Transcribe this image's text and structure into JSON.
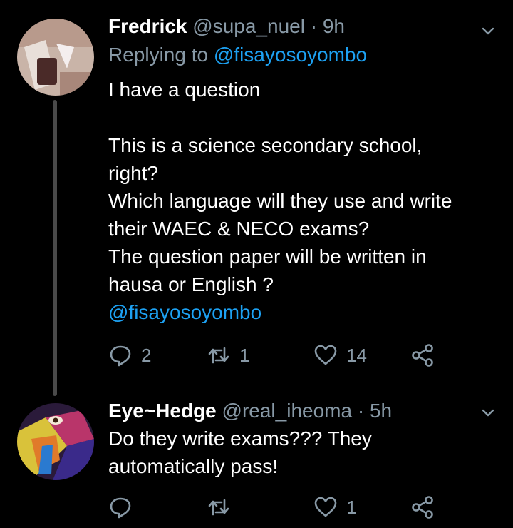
{
  "tweets": [
    {
      "name": "Fredrick",
      "handle": "@supa_nuel",
      "separator": "·",
      "time": "9h",
      "replying_prefix": "Replying to",
      "replying_to": "@fisayosoyombo",
      "body_lines": [
        "I have a question",
        "",
        "This is a science secondary school,",
        "right?",
        "Which language will they use and write",
        "their WAEC & NECO exams?",
        "The question paper will be written in",
        "hausa or English ?"
      ],
      "body_mention": "@fisayosoyombo",
      "reply_count": "2",
      "retweet_count": "1",
      "like_count": "14"
    },
    {
      "name": "Eye~Hedge",
      "handle": "@real_iheoma",
      "separator": "·",
      "time": "5h",
      "body_lines": [
        "Do they write exams??? They",
        "automatically pass!"
      ],
      "reply_count": "",
      "retweet_count": "",
      "like_count": "1"
    }
  ],
  "icons": {
    "avatar1": "avatar-photo",
    "avatar2": "avatar-painted-face",
    "chevron": "chevron-down-icon",
    "reply": "reply-icon",
    "retweet": "retweet-icon",
    "like": "heart-icon",
    "share": "share-icon"
  },
  "colors": {
    "background": "#000000",
    "muted": "#8899a6",
    "link": "#1da1f2",
    "thread_line": "#4a4a4a"
  }
}
